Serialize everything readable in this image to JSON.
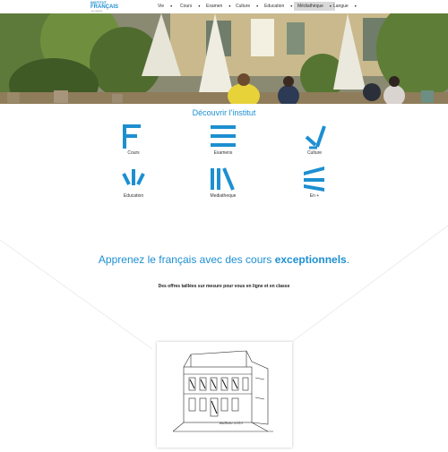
{
  "brand": {
    "line1": "INSTITUT",
    "line2": "FRANÇAIS",
    "line3": "ALLEMAGNE",
    "accent_color": "#1d8fd1"
  },
  "nav": {
    "items": [
      {
        "label": "Vie",
        "icon": "caret-down-icon"
      },
      {
        "label": "Cours",
        "icon": "caret-down-icon"
      },
      {
        "label": "Examen",
        "icon": "caret-down-icon"
      },
      {
        "label": "Culture",
        "icon": "caret-down-icon"
      },
      {
        "label": "Education",
        "icon": "caret-down-icon"
      },
      {
        "label": "Médiathèque",
        "icon": "caret-down-icon",
        "active": true
      },
      {
        "label": "Langue",
        "icon": "caret-down-icon"
      }
    ]
  },
  "discover": {
    "title": "Découvrir l'institut",
    "tiles": [
      {
        "label": "Cours",
        "icon": "cours-icon"
      },
      {
        "label": "Examens",
        "icon": "examens-icon"
      },
      {
        "label": "Culture",
        "icon": "culture-icon"
      },
      {
        "label": "Education",
        "icon": "education-icon"
      },
      {
        "label": "Mediatheque",
        "icon": "mediatheque-icon"
      },
      {
        "label": "En +",
        "icon": "en-plus-icon"
      }
    ]
  },
  "promo": {
    "headline_part1": "Apprenez le français avec des cours ",
    "headline_bold": "exceptionnels",
    "headline_end": ".",
    "subline": "Des offres taillées sur mesure pour vous en ligne et en classe"
  },
  "sketch": {
    "signature": "Bulloto 2013"
  }
}
